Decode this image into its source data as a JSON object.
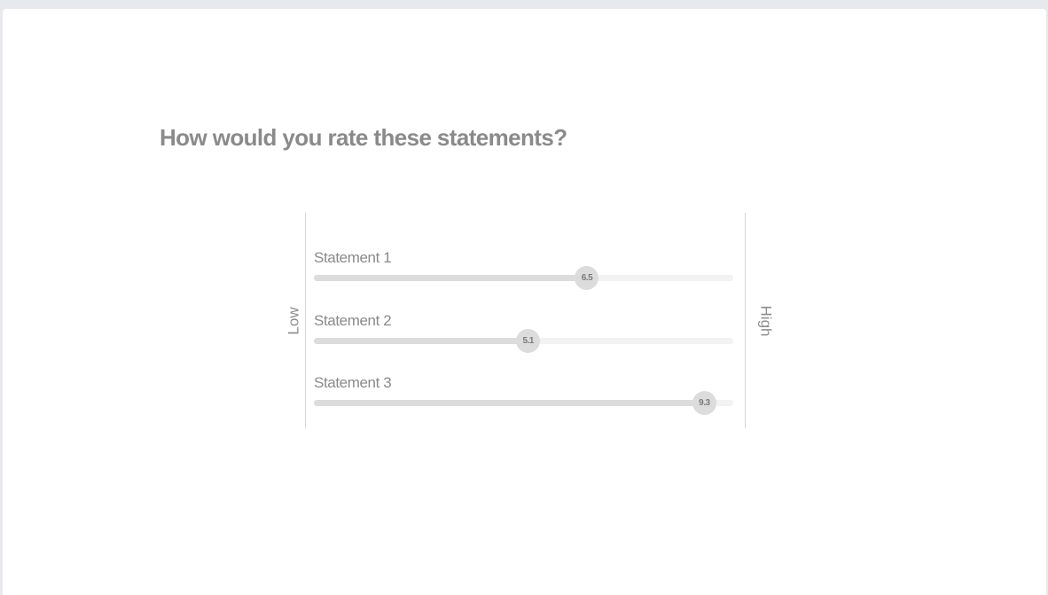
{
  "question": "How would you rate these statements?",
  "scale": {
    "low_label": "Low",
    "high_label": "High",
    "min": 0,
    "max": 10
  },
  "statements": [
    {
      "label": "Statement 1",
      "value": 6.5,
      "value_text": "6.5"
    },
    {
      "label": "Statement 2",
      "value": 5.1,
      "value_text": "5.1"
    },
    {
      "label": "Statement 3",
      "value": 9.3,
      "value_text": "9.3"
    }
  ]
}
